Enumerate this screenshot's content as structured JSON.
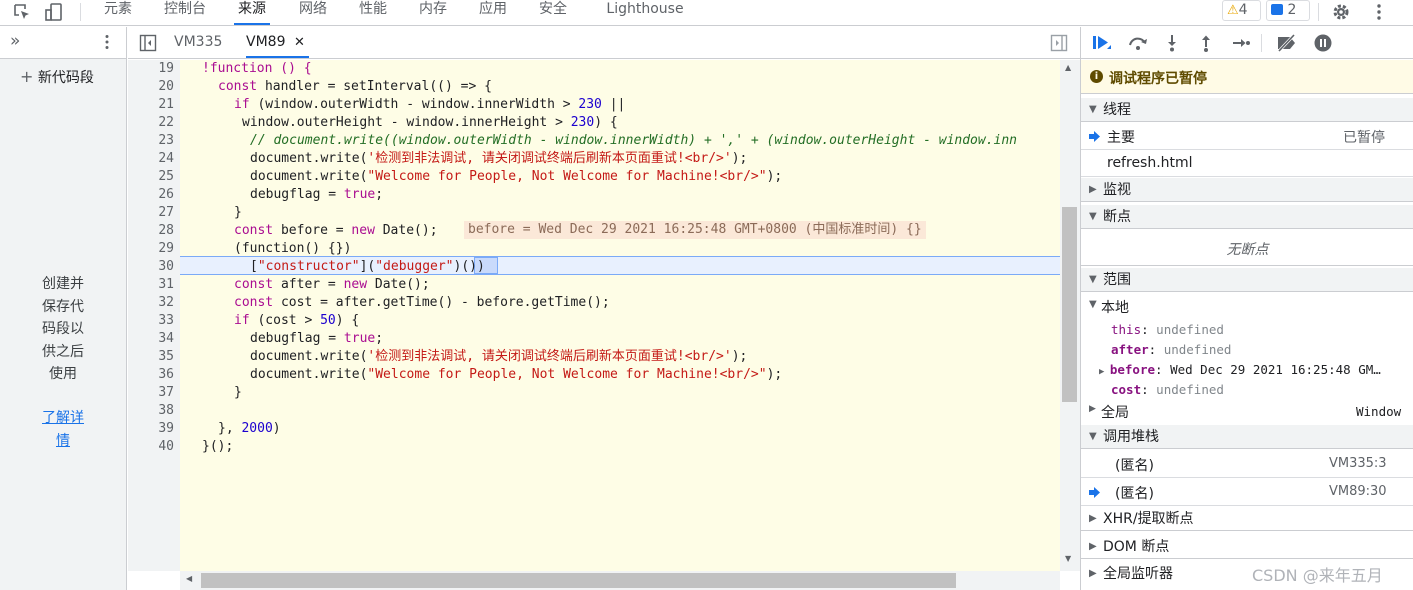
{
  "toolbar": {
    "tabs": [
      "元素",
      "控制台",
      "来源",
      "网络",
      "性能",
      "内存",
      "应用",
      "安全",
      "Lighthouse"
    ],
    "warning_count": "4",
    "message_count": "2"
  },
  "navigator": {
    "new_snippet_label": "新代码段",
    "hint_lines": [
      "创建并",
      "保存代",
      "码段以",
      "供之后",
      "使用"
    ],
    "learn_more_lines": [
      "了解详",
      "情"
    ]
  },
  "editor": {
    "tabs": [
      "VM335",
      "VM89"
    ],
    "active_tab": "VM89",
    "line_numbers": [
      "19",
      "20",
      "21",
      "22",
      "23",
      "24",
      "25",
      "26",
      "27",
      "28",
      "29",
      "30",
      "31",
      "32",
      "33",
      "34",
      "35",
      "36",
      "37",
      "38",
      "39",
      "40"
    ],
    "inline_value": "before = Wed Dec 29 2021 16:25:48 GMT+0800 (中国标准时间) {}",
    "code": {
      "l19": "!function () {",
      "l20a": "const",
      "l20b": " handler = setInterval(() => {",
      "l21a": "if",
      "l21b": " (window.outerWidth - window.innerWidth > ",
      "l21c": "230",
      "l21d": " ||",
      "l22a": "window.outerHeight - window.innerHeight > ",
      "l22b": "230",
      "l22c": ") {",
      "l23": "// document.write((window.outerWidth - window.innerWidth) + ',' + (window.outerHeight - window.inn",
      "l24a": "document.write(",
      "l24b": "'检测到非法调试, 请关闭调试终端后刷新本页面重试!<br/>'",
      "l24c": ");",
      "l25a": "document.write(",
      "l25b": "\"Welcome for People, Not Welcome for Machine!<br/>\"",
      "l25c": ");",
      "l26a": "debugflag = ",
      "l26b": "true",
      "l26c": ";",
      "l27": "}",
      "l28a": "const",
      "l28b": " before = ",
      "l28c": "new",
      "l28d": " Date();",
      "l29": "(function() {})",
      "l30a": "[",
      "l30b": "\"constructor\"",
      "l30c": "](",
      "l30d": "\"debugger\"",
      "l30e": ")())",
      "l31a": "const",
      "l31b": " after = ",
      "l31c": "new",
      "l31d": " Date();",
      "l32a": "const",
      "l32b": " cost = after.getTime() - before.getTime();",
      "l33a": "if",
      "l33b": " (cost > ",
      "l33c": "50",
      "l33d": ") {",
      "l34a": "debugflag = ",
      "l34b": "true",
      "l34c": ";",
      "l35a": "document.write(",
      "l35b": "'检测到非法调试, 请关闭调试终端后刷新本页面重试!<br/>'",
      "l35c": ");",
      "l36a": "document.write(",
      "l36b": "\"Welcome for People, Not Welcome for Machine!<br/>\"",
      "l36c": ");",
      "l37": "}",
      "l39a": "}, ",
      "l39b": "2000",
      "l39c": ")",
      "l40": "}();"
    }
  },
  "sidebar": {
    "paused_message": "调试程序已暂停",
    "threads_title": "线程",
    "thread_main": "主要",
    "thread_main_status": "已暂停",
    "thread_file": "refresh.html",
    "watch_title": "监视",
    "breakpoints_title": "断点",
    "no_breakpoints": "无断点",
    "scope_title": "范围",
    "local_title": "本地",
    "scope_vars": {
      "this_name": "this",
      "this_value": "undefined",
      "after_name": "after",
      "after_value": "undefined",
      "before_name": "before",
      "before_value": "Wed Dec 29 2021 16:25:48 GM…",
      "cost_name": "cost",
      "cost_value": "undefined"
    },
    "global_title": "全局",
    "global_value": "Window",
    "callstack_title": "调用堆栈",
    "frames": [
      {
        "name": "(匿名)",
        "location": "VM335:3"
      },
      {
        "name": "(匿名)",
        "location": "VM89:30"
      }
    ],
    "xhr_title": "XHR/提取断点",
    "dom_title": "DOM 断点",
    "global_listeners_title": "全局监听器"
  },
  "watermark": "CSDN @来年五月"
}
